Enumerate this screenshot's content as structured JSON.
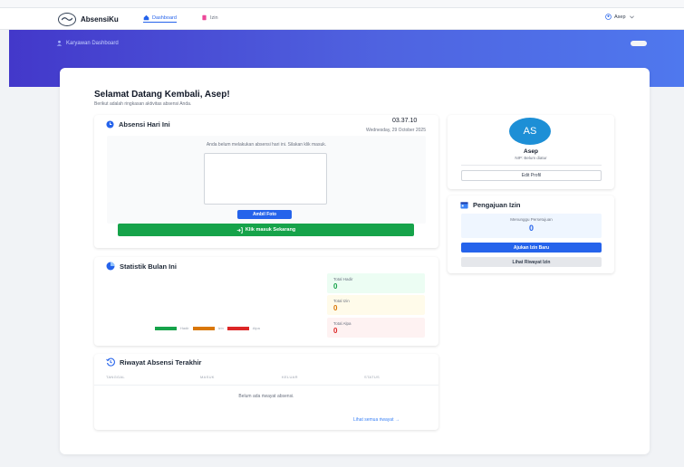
{
  "colors": {
    "accent": "#2563eb",
    "success": "#16a34a",
    "hero_start": "#4338ca",
    "hero_end": "#4f78ee",
    "hadir": "#16a34a",
    "izin": "#d97706",
    "alpa": "#dc2626"
  },
  "navbar": {
    "brand": "AbsensiKu",
    "brand_icon": "wave-logo-icon",
    "links": [
      {
        "label": "Dashboard",
        "icon": "home-icon",
        "active": true
      },
      {
        "label": "Izin",
        "icon": "document-icon",
        "active": false
      }
    ],
    "user": {
      "name": "Asep",
      "icon": "user-circle-icon",
      "dropdown_icon": "chevron-down-icon"
    }
  },
  "hero": {
    "title": "Karyawan Dashboard",
    "icon": "user-icon"
  },
  "welcome": {
    "title": "Selamat Datang Kembali, Asep!",
    "subtitle": "Berikut adalah ringkasan aktivitas absensi Anda."
  },
  "absensi": {
    "title": "Absensi Hari Ini",
    "icon": "clock-icon",
    "time": "03.37.10",
    "date": "Wednesday, 29 October 2025",
    "message": "Anda belum melakukan absensi hari ini. Silakan klik masuk.",
    "photo_button": "Ambil Foto",
    "checkin_button": "Klik masuk Sekarang",
    "checkin_icon": "login-icon"
  },
  "statistik": {
    "title": "Statistik Bulan Ini",
    "icon": "chart-pie-icon",
    "legend": [
      {
        "label": "Hadir",
        "color": "#16a34a"
      },
      {
        "label": "Izin",
        "color": "#d97706"
      },
      {
        "label": "Alpa",
        "color": "#dc2626"
      }
    ],
    "cards": [
      {
        "label": "Total Hadir",
        "value": "0",
        "bg": "#ecfdf3",
        "fg": "#16a34a"
      },
      {
        "label": "Total Izin",
        "value": "0",
        "bg": "#fffbea",
        "fg": "#d97706"
      },
      {
        "label": "Total Alpa",
        "value": "0",
        "bg": "#fef2f2",
        "fg": "#dc2626"
      }
    ]
  },
  "riwayat": {
    "title": "Riwayat Absensi Terakhir",
    "icon": "history-icon",
    "columns": [
      "TANGGAL",
      "MASUK",
      "KELUAR",
      "STATUS"
    ],
    "empty_text": "Belum ada riwayat absensi.",
    "see_all": "Lihat semua riwayat →"
  },
  "profile": {
    "initials": "AS",
    "name": "Asep",
    "nip": "NIP: Belum diatur",
    "edit_button": "Edit Profil"
  },
  "izin": {
    "title": "Pengajuan Izin",
    "icon": "calendar-icon",
    "pending_label": "Menunggu Persetujuan",
    "pending_value": "0",
    "submit_button": "Ajukan Izin Baru",
    "history_button": "Lihat Riwayat Izin"
  }
}
